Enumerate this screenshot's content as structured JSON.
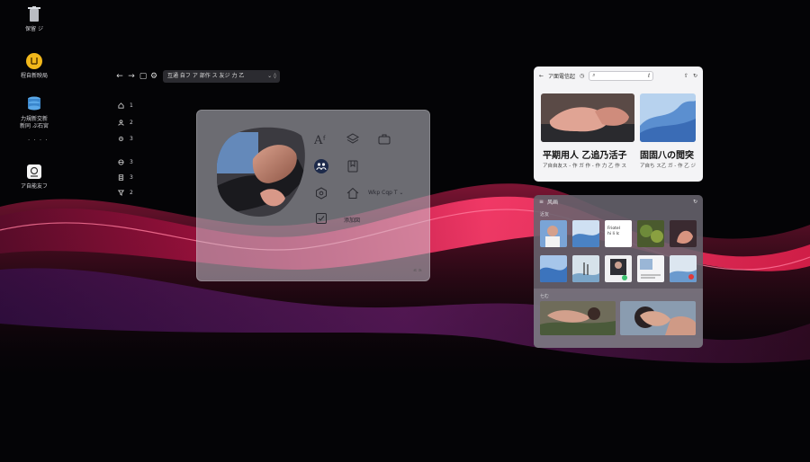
{
  "desktop": {
    "icons": [
      {
        "label": "保留 ジ",
        "icon": "trash-bin-icon"
      },
      {
        "label": "程自新映局",
        "icon": "yellow-app-icon"
      },
      {
        "label": "力規新交新\n新同 ぶ石宮",
        "icon": "database-stack-icon"
      },
      {
        "label": "ア自能友フ",
        "icon": "shield-app-icon"
      }
    ],
    "dots": "· · · ·"
  },
  "browser": {
    "url": "互通 自フ ア 部作 ス 友ジ 力 乙",
    "url_tail": "⌄  ◊"
  },
  "mini_sidebar": {
    "items": [
      {
        "label": "1",
        "icon": "home-icon"
      },
      {
        "label": "2",
        "icon": "person-icon"
      },
      {
        "label": "3",
        "icon": "settings-icon"
      },
      {
        "label": "3",
        "icon": "globe-icon"
      },
      {
        "label": "3",
        "icon": "document-icon"
      },
      {
        "label": "2",
        "icon": "filter-icon"
      }
    ]
  },
  "glass_card": {
    "features": [
      {
        "icon": "text-style-icon",
        "label": ""
      },
      {
        "icon": "layers-icon",
        "label": ""
      },
      {
        "icon": "briefcase-icon",
        "label": ""
      },
      {
        "icon": "people-icon",
        "label": ""
      },
      {
        "icon": "bookmark-icon",
        "label": ""
      },
      {
        "icon": "network-icon",
        "label": ""
      },
      {
        "icon": "house-icon",
        "label": "Wkp Cqp T ⌄"
      },
      {
        "icon": "checklist-icon",
        "label": "添加図"
      }
    ],
    "corner": "≤ ≥"
  },
  "news_panel": {
    "title": "ア面電信起",
    "search_placeholder": "",
    "search_suffix": "ℓ",
    "headline_left": "平期用人 乙追乃活子 ",
    "headline_right": "固固八の閲突",
    "sub_left": "ア自自友ス - 作 ガ 作 - 作 力 乙 作 ス",
    "sub_right": "ア自ち ス乙 ガ - 作 乙 ジ"
  },
  "gallery_panel": {
    "title": "风画",
    "section1": "近友",
    "section2": "七む",
    "tile_caption": "Friotel\nhi li Ic"
  },
  "colors": {
    "accent_red": "#c8143c",
    "wave_pink": "#ff4a78",
    "glass": "#cdcdd7",
    "panel_dark": "#68646e"
  }
}
